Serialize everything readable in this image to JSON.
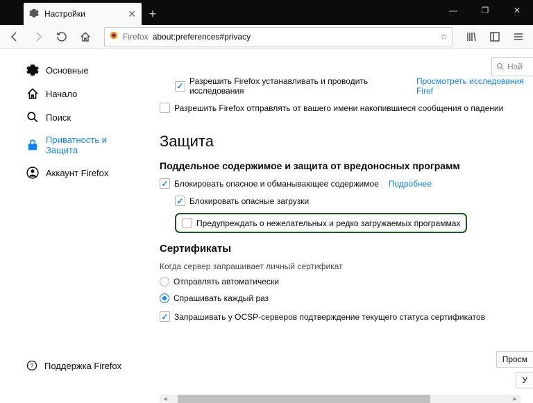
{
  "window_controls": {
    "minimize": "—",
    "maximize": "❐",
    "close": "✕"
  },
  "tab": {
    "title": "Настройки",
    "close": "✕"
  },
  "toolbar": {
    "url_badge": "Firefox",
    "url": "about:preferences#privacy"
  },
  "search": {
    "placeholder": "Най"
  },
  "sidebar": {
    "items": [
      {
        "label": "Основные"
      },
      {
        "label": "Начало"
      },
      {
        "label": "Поиск"
      },
      {
        "label": "Приватность и Защита"
      },
      {
        "label": "Аккаунт Firefox"
      }
    ],
    "support": "Поддержка Firefox"
  },
  "main": {
    "top_rows": [
      {
        "label": "Разрешить Firefox устанавливать и проводить исследования",
        "link": "Просмотреть исследования Firef"
      },
      {
        "label": "Разрешить Firefox отправлять от вашего имени накопившиеся сообщения о падении"
      }
    ],
    "section_security": "Защита",
    "subsection_deceptive": "Поддельное содержимое и защита от вредоносных программ",
    "block_dangerous": "Блокировать опасное и обманывающее содержимое",
    "block_dangerous_link": "Подробнее",
    "block_downloads": "Блокировать опасные загрузки",
    "warn_unwanted": "Предупреждать о нежелательных и редко загружаемых программах",
    "section_certs": "Сертификаты",
    "certs_subtext": "Когда сервер запрашивает личный сертификат",
    "certs_auto": "Отправлять автоматически",
    "certs_ask": "Спрашивать каждый раз",
    "certs_ocsp": "Запрашивать у OCSP-серверов подтверждение текущего статуса сертификатов",
    "btn_view": "Просм",
    "btn_devices": "У"
  }
}
